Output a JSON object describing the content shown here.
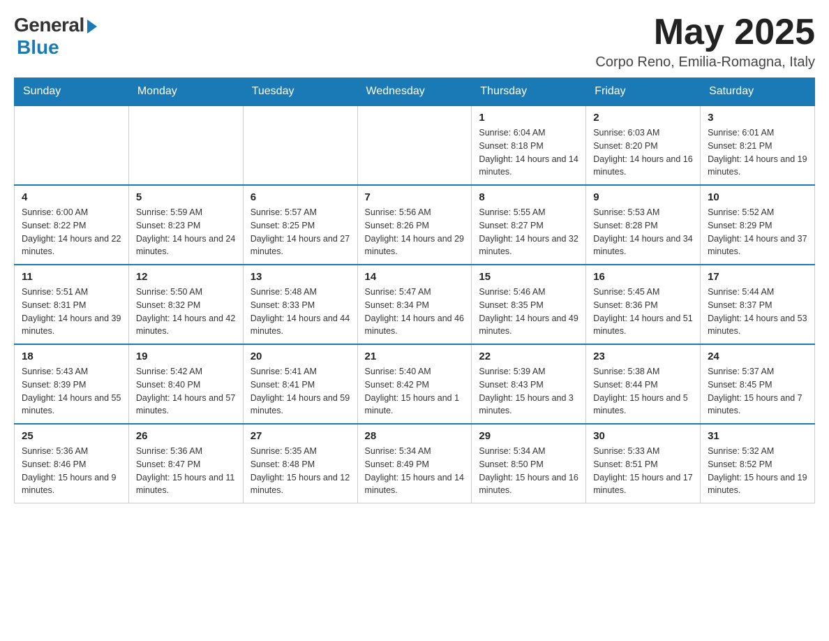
{
  "logo": {
    "general": "General",
    "blue": "Blue"
  },
  "title": {
    "month_year": "May 2025",
    "location": "Corpo Reno, Emilia-Romagna, Italy"
  },
  "days_of_week": [
    "Sunday",
    "Monday",
    "Tuesday",
    "Wednesday",
    "Thursday",
    "Friday",
    "Saturday"
  ],
  "weeks": [
    [
      {
        "day": "",
        "info": ""
      },
      {
        "day": "",
        "info": ""
      },
      {
        "day": "",
        "info": ""
      },
      {
        "day": "",
        "info": ""
      },
      {
        "day": "1",
        "info": "Sunrise: 6:04 AM\nSunset: 8:18 PM\nDaylight: 14 hours and 14 minutes."
      },
      {
        "day": "2",
        "info": "Sunrise: 6:03 AM\nSunset: 8:20 PM\nDaylight: 14 hours and 16 minutes."
      },
      {
        "day": "3",
        "info": "Sunrise: 6:01 AM\nSunset: 8:21 PM\nDaylight: 14 hours and 19 minutes."
      }
    ],
    [
      {
        "day": "4",
        "info": "Sunrise: 6:00 AM\nSunset: 8:22 PM\nDaylight: 14 hours and 22 minutes."
      },
      {
        "day": "5",
        "info": "Sunrise: 5:59 AM\nSunset: 8:23 PM\nDaylight: 14 hours and 24 minutes."
      },
      {
        "day": "6",
        "info": "Sunrise: 5:57 AM\nSunset: 8:25 PM\nDaylight: 14 hours and 27 minutes."
      },
      {
        "day": "7",
        "info": "Sunrise: 5:56 AM\nSunset: 8:26 PM\nDaylight: 14 hours and 29 minutes."
      },
      {
        "day": "8",
        "info": "Sunrise: 5:55 AM\nSunset: 8:27 PM\nDaylight: 14 hours and 32 minutes."
      },
      {
        "day": "9",
        "info": "Sunrise: 5:53 AM\nSunset: 8:28 PM\nDaylight: 14 hours and 34 minutes."
      },
      {
        "day": "10",
        "info": "Sunrise: 5:52 AM\nSunset: 8:29 PM\nDaylight: 14 hours and 37 minutes."
      }
    ],
    [
      {
        "day": "11",
        "info": "Sunrise: 5:51 AM\nSunset: 8:31 PM\nDaylight: 14 hours and 39 minutes."
      },
      {
        "day": "12",
        "info": "Sunrise: 5:50 AM\nSunset: 8:32 PM\nDaylight: 14 hours and 42 minutes."
      },
      {
        "day": "13",
        "info": "Sunrise: 5:48 AM\nSunset: 8:33 PM\nDaylight: 14 hours and 44 minutes."
      },
      {
        "day": "14",
        "info": "Sunrise: 5:47 AM\nSunset: 8:34 PM\nDaylight: 14 hours and 46 minutes."
      },
      {
        "day": "15",
        "info": "Sunrise: 5:46 AM\nSunset: 8:35 PM\nDaylight: 14 hours and 49 minutes."
      },
      {
        "day": "16",
        "info": "Sunrise: 5:45 AM\nSunset: 8:36 PM\nDaylight: 14 hours and 51 minutes."
      },
      {
        "day": "17",
        "info": "Sunrise: 5:44 AM\nSunset: 8:37 PM\nDaylight: 14 hours and 53 minutes."
      }
    ],
    [
      {
        "day": "18",
        "info": "Sunrise: 5:43 AM\nSunset: 8:39 PM\nDaylight: 14 hours and 55 minutes."
      },
      {
        "day": "19",
        "info": "Sunrise: 5:42 AM\nSunset: 8:40 PM\nDaylight: 14 hours and 57 minutes."
      },
      {
        "day": "20",
        "info": "Sunrise: 5:41 AM\nSunset: 8:41 PM\nDaylight: 14 hours and 59 minutes."
      },
      {
        "day": "21",
        "info": "Sunrise: 5:40 AM\nSunset: 8:42 PM\nDaylight: 15 hours and 1 minute."
      },
      {
        "day": "22",
        "info": "Sunrise: 5:39 AM\nSunset: 8:43 PM\nDaylight: 15 hours and 3 minutes."
      },
      {
        "day": "23",
        "info": "Sunrise: 5:38 AM\nSunset: 8:44 PM\nDaylight: 15 hours and 5 minutes."
      },
      {
        "day": "24",
        "info": "Sunrise: 5:37 AM\nSunset: 8:45 PM\nDaylight: 15 hours and 7 minutes."
      }
    ],
    [
      {
        "day": "25",
        "info": "Sunrise: 5:36 AM\nSunset: 8:46 PM\nDaylight: 15 hours and 9 minutes."
      },
      {
        "day": "26",
        "info": "Sunrise: 5:36 AM\nSunset: 8:47 PM\nDaylight: 15 hours and 11 minutes."
      },
      {
        "day": "27",
        "info": "Sunrise: 5:35 AM\nSunset: 8:48 PM\nDaylight: 15 hours and 12 minutes."
      },
      {
        "day": "28",
        "info": "Sunrise: 5:34 AM\nSunset: 8:49 PM\nDaylight: 15 hours and 14 minutes."
      },
      {
        "day": "29",
        "info": "Sunrise: 5:34 AM\nSunset: 8:50 PM\nDaylight: 15 hours and 16 minutes."
      },
      {
        "day": "30",
        "info": "Sunrise: 5:33 AM\nSunset: 8:51 PM\nDaylight: 15 hours and 17 minutes."
      },
      {
        "day": "31",
        "info": "Sunrise: 5:32 AM\nSunset: 8:52 PM\nDaylight: 15 hours and 19 minutes."
      }
    ]
  ]
}
